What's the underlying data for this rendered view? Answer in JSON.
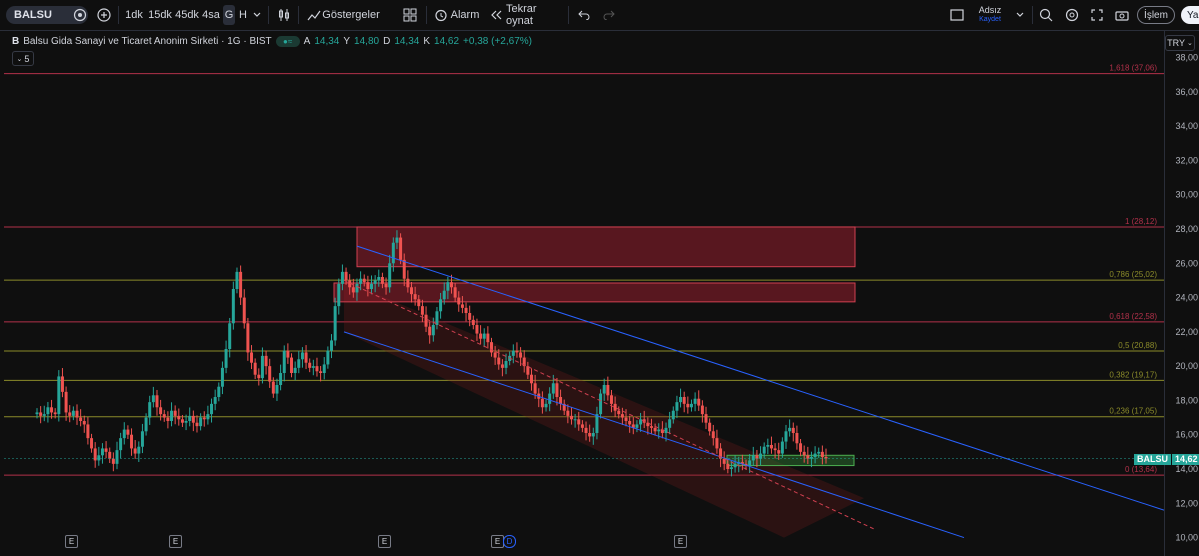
{
  "toolbar": {
    "symbol": "BALSU",
    "intervals": [
      "1dk",
      "15dk",
      "45dk",
      "4sa",
      "G",
      "H"
    ],
    "indicators_label": "Göstergeler",
    "alarm_label": "Alarm",
    "replay_label": "Tekrar oynat",
    "layout_name": "Adsız",
    "layout_save": "Kaydet",
    "trade_label": "İşlem",
    "publish_label": "Ya"
  },
  "legend": {
    "title": "Balsu Gida Sanayi ve Ticaret Anonim Sirketi · 1G · BIST",
    "open_k": "A",
    "open_v": "14,34",
    "high_k": "Y",
    "high_v": "14,80",
    "low_k": "D",
    "low_v": "14,34",
    "close_k": "K",
    "close_v": "14,62",
    "change": "+0,38 (+2,67%)",
    "sub_count": "5"
  },
  "currency": "TRY",
  "badge": {
    "symbol": "BALSU",
    "price": "14,62"
  },
  "event_marker": "E",
  "colors": {
    "up": "#26a69a",
    "down": "#ef5350",
    "fib_red": "#b2314a",
    "fib_olive": "#8b8b2a",
    "channel": "#2962ff",
    "zone": "#b22234",
    "green_zone": "#2e7d32"
  },
  "chart_data": {
    "type": "candlestick",
    "symbol": "BALSU",
    "currency": "TRY",
    "ylim": [
      10,
      38.5
    ],
    "y_ticks": [
      "10,00",
      "12,00",
      "14,00",
      "16,00",
      "18,00",
      "20,00",
      "22,00",
      "24,00",
      "26,00",
      "28,00",
      "30,00",
      "32,00",
      "34,00",
      "36,00",
      "38,00"
    ],
    "last_price": 14.62,
    "fib_levels": [
      {
        "ratio": "1,618",
        "price": "37,06",
        "value": 37.06,
        "color": "#b2314a"
      },
      {
        "ratio": "1",
        "price": "28,12",
        "value": 28.12,
        "color": "#b2314a"
      },
      {
        "ratio": "0,786",
        "price": "25,02",
        "value": 25.02,
        "color": "#8b8b2a"
      },
      {
        "ratio": "0,618",
        "price": "22,58",
        "value": 22.58,
        "color": "#b2314a"
      },
      {
        "ratio": "0,5",
        "price": "20,88",
        "value": 20.88,
        "color": "#8b8b2a"
      },
      {
        "ratio": "0,382",
        "price": "19,17",
        "value": 19.17,
        "color": "#8b8b2a"
      },
      {
        "ratio": "0,236",
        "price": "17,05",
        "value": 17.05,
        "color": "#8b8b2a"
      },
      {
        "ratio": "0",
        "price": "13,64",
        "value": 13.64,
        "color": "#b2314a"
      }
    ],
    "closes": [
      17.3,
      17.1,
      17.2,
      17.6,
      17.3,
      17.2,
      19.4,
      18.5,
      17.3,
      17.1,
      17.4,
      17.0,
      16.8,
      16.6,
      15.8,
      15.2,
      14.5,
      14.8,
      15.2,
      15.0,
      14.6,
      14.3,
      15.1,
      15.8,
      16.3,
      16.0,
      15.2,
      14.9,
      15.3,
      16.2,
      17.0,
      17.9,
      18.3,
      17.6,
      17.2,
      17.0,
      16.8,
      17.4,
      17.1,
      16.9,
      16.7,
      16.8,
      17.1,
      16.7,
      16.5,
      17.0,
      16.9,
      17.2,
      17.8,
      18.2,
      18.8,
      19.9,
      21.0,
      22.5,
      24.5,
      25.5,
      24.0,
      22.5,
      20.8,
      20.2,
      19.5,
      19.3,
      20.6,
      20.0,
      19.1,
      18.4,
      18.9,
      19.6,
      20.9,
      20.5,
      19.6,
      19.9,
      20.4,
      20.8,
      20.2,
      19.9,
      20.0,
      19.7,
      19.6,
      20.1,
      20.9,
      21.5,
      23.5,
      24.8,
      25.5,
      25.0,
      24.6,
      24.3,
      24.8,
      25.1,
      24.9,
      24.5,
      24.8,
      25.0,
      25.2,
      24.8,
      24.6,
      26.0,
      27.2,
      27.5,
      26.2,
      25.1,
      24.6,
      24.2,
      23.9,
      23.5,
      23.0,
      22.3,
      21.8,
      22.4,
      23.2,
      23.9,
      24.4,
      24.9,
      24.6,
      24.0,
      23.6,
      23.4,
      23.1,
      22.7,
      22.4,
      21.9,
      21.6,
      21.9,
      21.4,
      20.8,
      20.5,
      20.1,
      19.9,
      20.3,
      20.6,
      20.9,
      20.8,
      20.5,
      20.0,
      19.5,
      19.0,
      18.4,
      18.1,
      17.6,
      17.8,
      18.4,
      19.0,
      18.2,
      17.8,
      17.4,
      17.1,
      16.9,
      16.9,
      16.6,
      16.4,
      16.1,
      15.9,
      16.1,
      17.2,
      18.4,
      18.9,
      18.3,
      17.8,
      17.4,
      17.2,
      17.0,
      16.8,
      16.6,
      16.4,
      16.6,
      16.9,
      16.7,
      16.5,
      16.4,
      16.2,
      16.3,
      16.1,
      16.4,
      16.9,
      17.4,
      17.9,
      18.2,
      17.8,
      17.6,
      17.8,
      18.1,
      17.7,
      17.2,
      16.7,
      16.2,
      15.8,
      15.2,
      14.6,
      14.3,
      14.0,
      14.1,
      14.3,
      14.4,
      14.3,
      14.2,
      14.5,
      14.8,
      14.6,
      14.9,
      15.3,
      15.4,
      15.2,
      15.1,
      14.9,
      15.6,
      16.2,
      16.4,
      16.1,
      15.5,
      15.0,
      14.8,
      14.6,
      14.7,
      14.9,
      15.0,
      14.7,
      14.62
    ]
  }
}
